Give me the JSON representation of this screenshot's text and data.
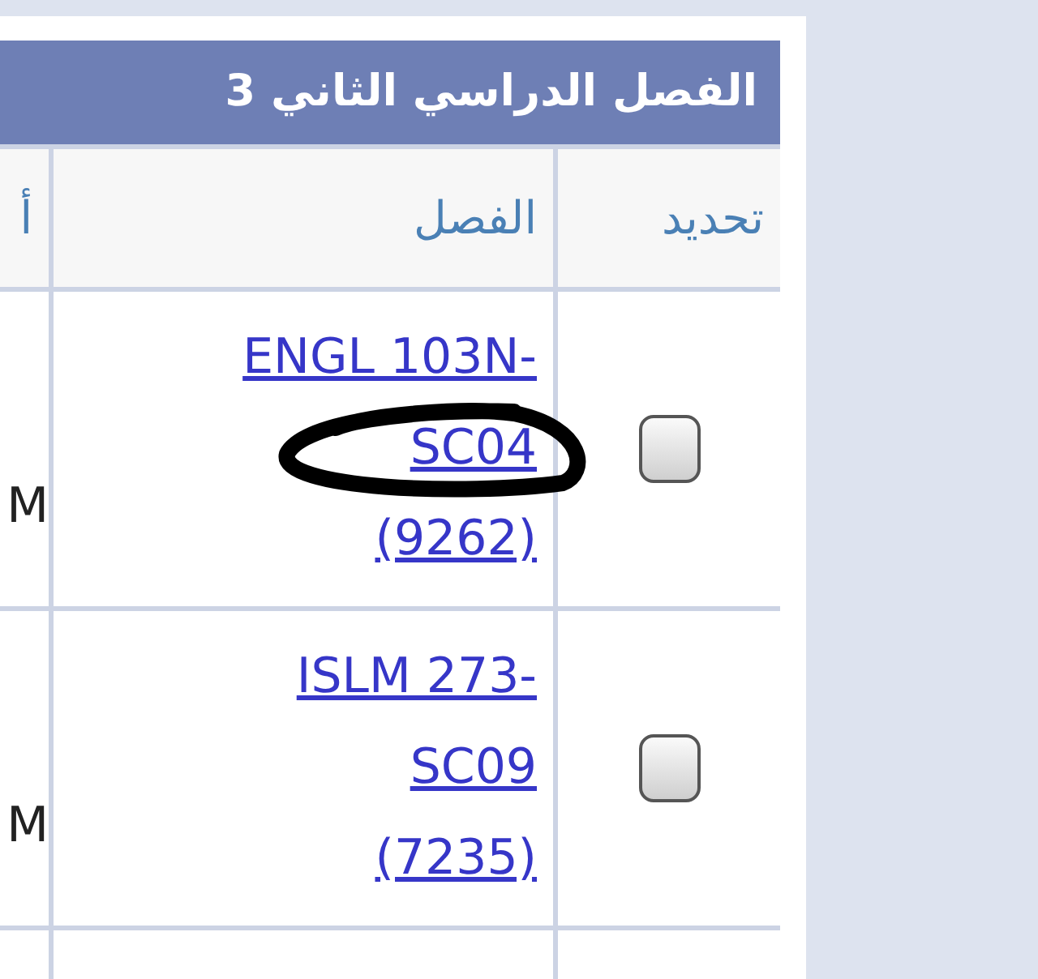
{
  "table": {
    "title": "الفصل الدراسي الثاني 3",
    "columns": [
      "تحديد",
      "الفصل",
      "أ"
    ],
    "rows": [
      {
        "selected": false,
        "section_lines": [
          "ENGL 103N-",
          "SC04",
          "(9262)"
        ],
        "column_3": "M",
        "circled": true
      },
      {
        "selected": false,
        "section_lines": [
          "ISLM 273-",
          "SC09",
          "(7235)"
        ],
        "column_3": "M",
        "circled": false
      }
    ]
  }
}
